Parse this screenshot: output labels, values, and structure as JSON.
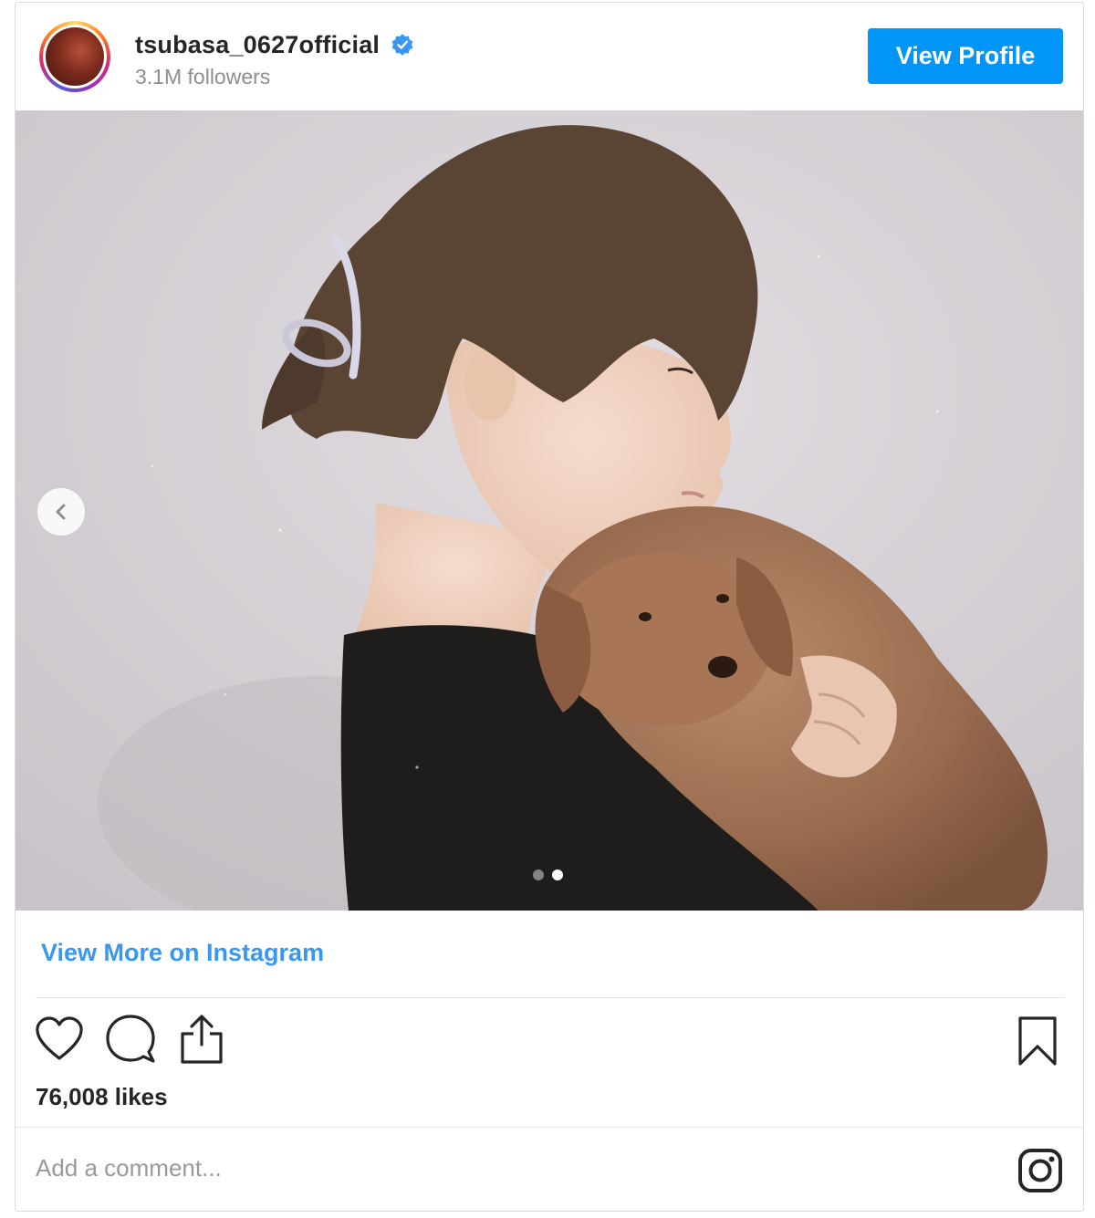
{
  "header": {
    "username": "tsubasa_0627official",
    "followers": "3.1M followers",
    "view_profile_label": "View Profile",
    "verified_icon": "verified-badge-icon",
    "verified_color": "#3897f0"
  },
  "media": {
    "description_icon": "photo",
    "carousel_total": 2,
    "carousel_active_index": 2,
    "prev_icon": "chevron-left-icon"
  },
  "footer": {
    "view_more_label": "View More on Instagram",
    "likes": "76,008 likes",
    "comment_placeholder": "Add a comment...",
    "icons": [
      "heart-icon",
      "comment-icon",
      "share-icon",
      "bookmark-icon",
      "instagram-logo-icon"
    ]
  },
  "colors": {
    "accent_blue": "#0095f6",
    "link_blue": "#3897f0",
    "text_primary": "#262626",
    "text_secondary": "#8e8e8e"
  }
}
